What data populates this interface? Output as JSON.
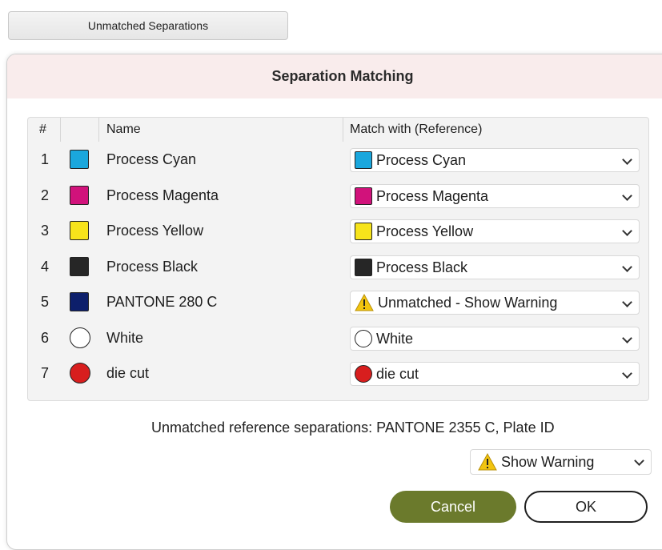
{
  "top_button": {
    "label": "Unmatched Separations"
  },
  "dialog": {
    "title": "Separation Matching",
    "columns": {
      "num": "#",
      "swatch": "",
      "name": "Name",
      "match": "Match with (Reference)"
    },
    "rows": [
      {
        "num": "1",
        "name": "Process Cyan",
        "color": "#1aa7dd",
        "shape": "square",
        "match": "Process Cyan",
        "match_color": "#1aa7dd",
        "match_icon": "swatch"
      },
      {
        "num": "2",
        "name": "Process Magenta",
        "color": "#d1127b",
        "shape": "square",
        "match": "Process Magenta",
        "match_color": "#d1127b",
        "match_icon": "swatch"
      },
      {
        "num": "3",
        "name": "Process Yellow",
        "color": "#f7e41b",
        "shape": "square",
        "match": "Process Yellow",
        "match_color": "#f7e41b",
        "match_icon": "swatch"
      },
      {
        "num": "4",
        "name": "Process Black",
        "color": "#262626",
        "shape": "square",
        "match": "Process Black",
        "match_color": "#262626",
        "match_icon": "swatch"
      },
      {
        "num": "5",
        "name": "PANTONE 280 C",
        "color": "#0d1f6b",
        "shape": "square",
        "match": "Unmatched - Show Warning",
        "match_color": "",
        "match_icon": "warning-icon"
      },
      {
        "num": "6",
        "name": "White",
        "color": "#ffffff",
        "shape": "circle",
        "match": "White",
        "match_color": "#ffffff",
        "match_icon": "swatch"
      },
      {
        "num": "7",
        "name": "die cut",
        "color": "#d81e1e",
        "shape": "circle",
        "match": "die cut",
        "match_color": "#d81e1e",
        "match_icon": "swatch"
      }
    ],
    "unmatched_reference_text": "Unmatched reference separations: PANTONE 2355 C, Plate ID",
    "warning_select": {
      "value": "Show Warning",
      "icon": "warning-icon"
    },
    "buttons": {
      "cancel": "Cancel",
      "ok": "OK"
    },
    "colors": {
      "title_bg": "#f9ecec",
      "cancel_bg": "#6b7a2c",
      "warning_yellow": "#f2c40f"
    }
  }
}
